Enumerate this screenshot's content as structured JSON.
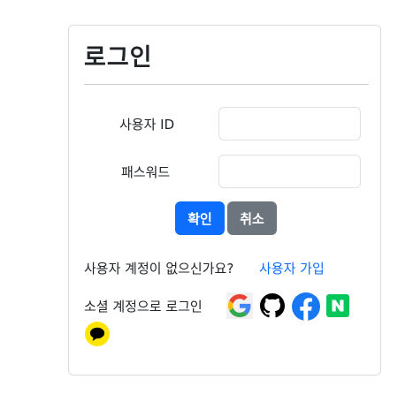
{
  "login": {
    "title": "로그인",
    "username_label": "사용자 ID",
    "password_label": "패스워드",
    "username_value": "",
    "password_value": "",
    "confirm_label": "확인",
    "cancel_label": "취소",
    "no_account_text": "사용자 계정이 없으신가요?",
    "signup_link": "사용자 가입",
    "social_login_text": "소셜 계정으로 로그인",
    "social_icons": [
      "google-icon",
      "github-icon",
      "facebook-icon",
      "naver-icon",
      "kakao-icon"
    ]
  },
  "colors": {
    "primary": "#0d6efd",
    "secondary": "#6c757d",
    "facebook": "#1877f2",
    "naver": "#03c75a",
    "kakao": "#fee500"
  }
}
